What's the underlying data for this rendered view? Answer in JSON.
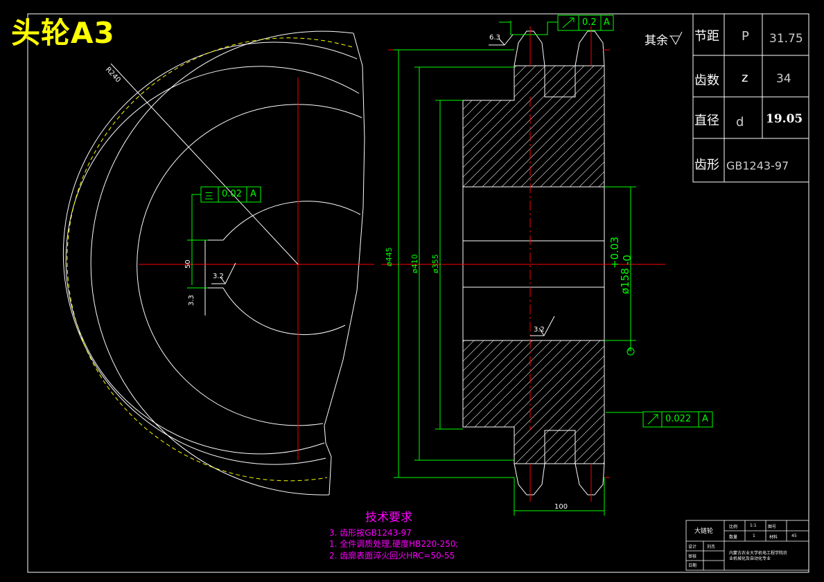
{
  "title": "头轮A3",
  "surface_note": "其余",
  "params": [
    {
      "name": "节距",
      "symbol": "P",
      "value": "31.75"
    },
    {
      "name": "齿数",
      "symbol": "z",
      "value": "34"
    },
    {
      "name": "直径",
      "symbol": "d",
      "value": "19.05"
    },
    {
      "name": "齿形",
      "symbol": "",
      "value": "GB1243-97"
    }
  ],
  "tolerances": {
    "runout_top": {
      "symbol": "↗",
      "value": "0.2",
      "datum": "A"
    },
    "symmetry": {
      "symbol": "三",
      "value": "0.02",
      "datum": "A"
    },
    "runout_side": {
      "symbol": "↗",
      "value": "0.022",
      "datum": "A"
    }
  },
  "dimensions": {
    "sr": "R240",
    "d445": "ø445",
    "d410": "ø410",
    "d355": "ø355",
    "bore": "ø158",
    "bore_tol": "+0.03",
    "bore_tol2": "-0",
    "width": "100",
    "key": "50",
    "rough_1": "6.3",
    "rough_2": "3.2",
    "rough_3": "3.2",
    "rough_4": "3.3",
    "datum": "A"
  },
  "tech_requirements": {
    "heading": "技术要求",
    "lines": [
      "3. 齿形按GB1243-97",
      "1. 全件调质处理,硬度HB220-250;",
      "2. 齿廓表面淬火回火HRC=50-55"
    ]
  },
  "title_block": {
    "part_name": "大链轮",
    "scale_label": "比例",
    "scale": "1:1",
    "drawing_no_label": "图号",
    "qty_label": "数量",
    "qty": "1",
    "material_label": "材料",
    "material": "45",
    "design_label": "设计",
    "check_label": "审核",
    "date_label": "日期",
    "designer": "刘杰",
    "school_1": "内蒙古农业大学机电工程学院农",
    "school_2": "业机械化及自动化专业"
  },
  "colors": {
    "background": "#000000",
    "outline": "#ffffff",
    "centerline": "#ff0000",
    "dimension": "#00ff00",
    "hidden": "#ffff00",
    "note": "#ff00ff"
  }
}
